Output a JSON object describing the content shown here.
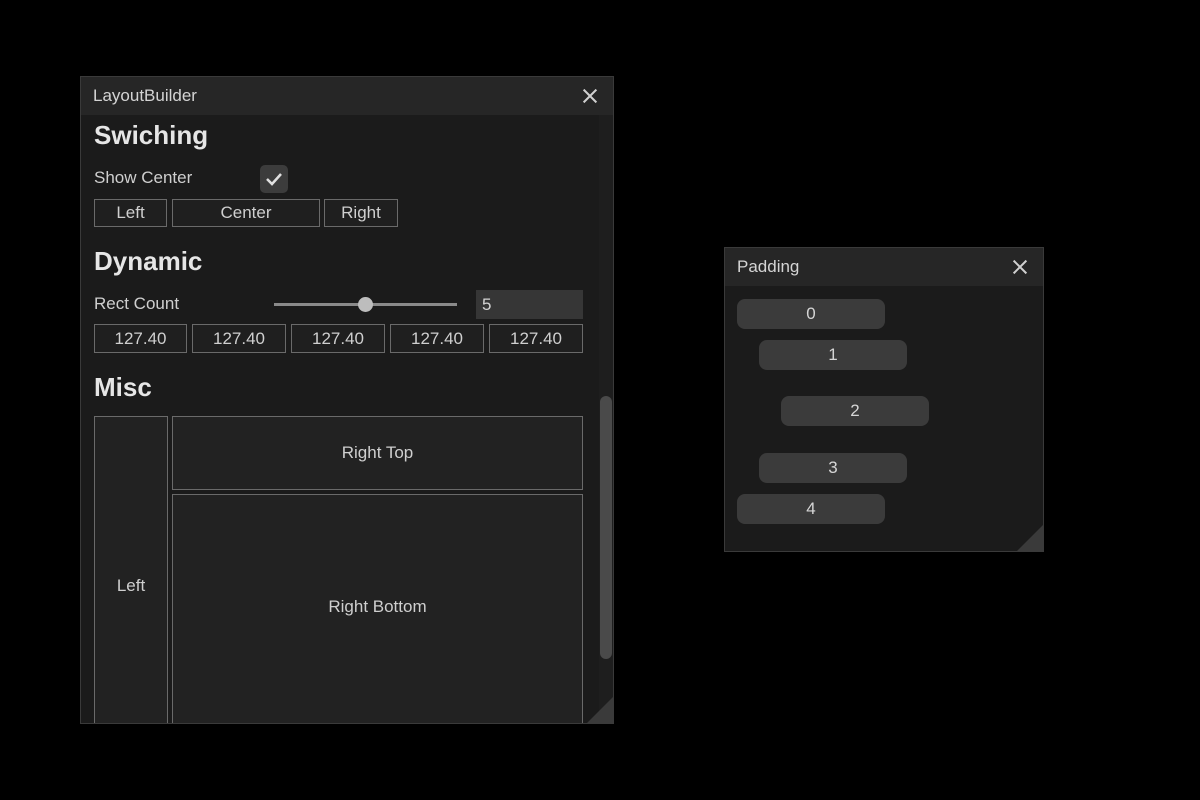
{
  "layout_window": {
    "title": "LayoutBuilder",
    "switching": {
      "heading": "Swiching",
      "show_center_label": "Show Center",
      "show_center_checked": true,
      "buttons": {
        "left": "Left",
        "center": "Center",
        "right": "Right"
      }
    },
    "dynamic": {
      "heading": "Dynamic",
      "rect_count_label": "Rect Count",
      "rect_count_value": "5",
      "slider_fraction": 0.5,
      "values": [
        "127.40",
        "127.40",
        "127.40",
        "127.40",
        "127.40"
      ]
    },
    "misc": {
      "heading": "Misc",
      "left": "Left",
      "right_top": "Right Top",
      "right_bottom": "Right Bottom"
    }
  },
  "padding_window": {
    "title": "Padding",
    "items": [
      "0",
      "1",
      "2",
      "3",
      "4"
    ]
  },
  "icons": {
    "close": "close-icon",
    "check": "check-icon"
  }
}
